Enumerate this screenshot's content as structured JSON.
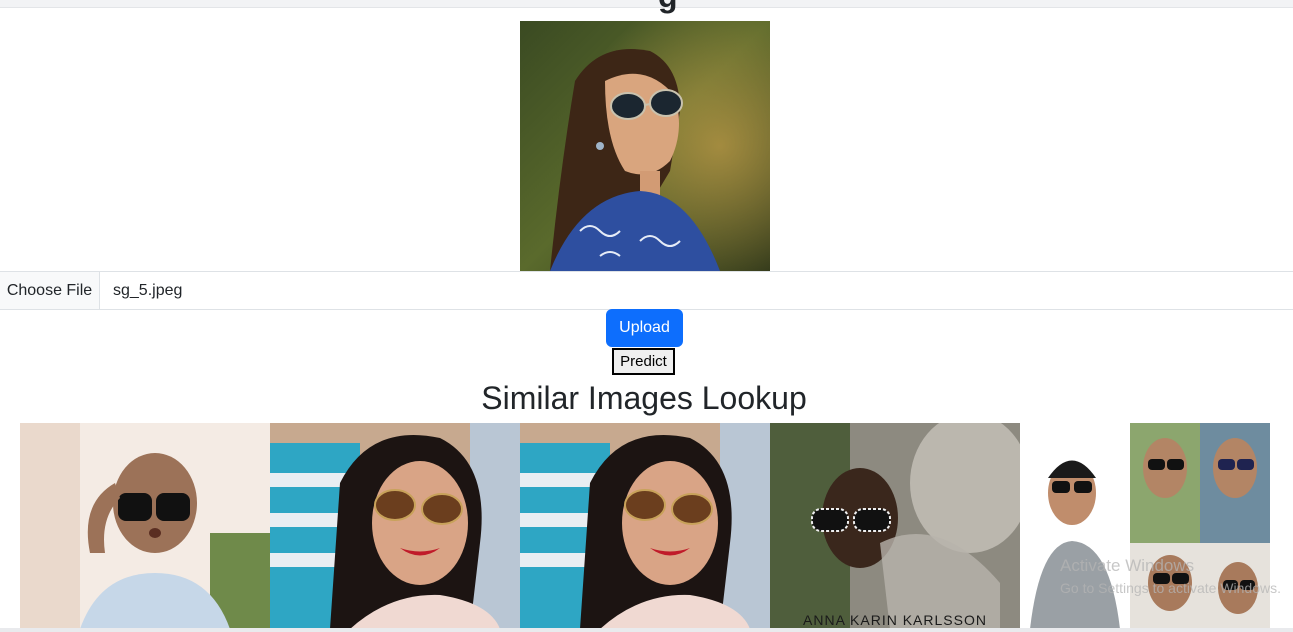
{
  "header": {
    "heading_fragment": "g"
  },
  "upload_form": {
    "choose_file_label": "Choose File",
    "selected_file": "sg_5.jpeg",
    "upload_label": "Upload",
    "predict_label": "Predict"
  },
  "similar": {
    "title": "Similar Images Lookup",
    "results": [
      {
        "alt": "bald woman with sunglasses"
      },
      {
        "alt": "woman with aviator sunglasses"
      },
      {
        "alt": "woman with aviator sunglasses duplicate"
      },
      {
        "alt": "woman with patterned sunglasses",
        "caption": "ANNA KARIN KARLSSON"
      },
      {
        "alt": "men with sunglasses collage"
      }
    ]
  },
  "watermark": {
    "line1": "Activate Windows",
    "line2": "Go to Settings to activate Windows."
  },
  "colors": {
    "primary": "#0d6efd",
    "text": "#212529",
    "border": "#dee2e6"
  }
}
